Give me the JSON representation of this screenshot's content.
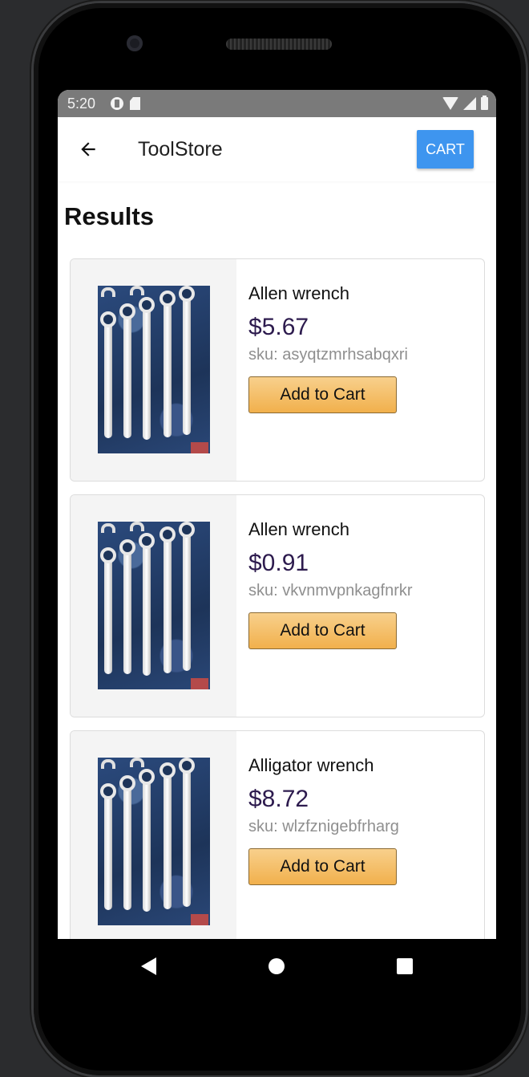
{
  "status_bar": {
    "time": "5:20",
    "left_icons": [
      "data-saver-icon",
      "sd-card-icon"
    ],
    "right_icons": [
      "wifi-icon",
      "signal-icon",
      "battery-icon"
    ]
  },
  "app_bar": {
    "back_icon": "arrow-left-icon",
    "title": "ToolStore",
    "cart_label": "CART",
    "cart_color": "#3e95ef"
  },
  "results": {
    "heading": "Results",
    "items": [
      {
        "name": "Allen wrench",
        "price": "$5.67",
        "sku": "sku: asyqtzmrhsabqxri",
        "button": "Add to Cart",
        "image": "wrench-set-image"
      },
      {
        "name": "Allen wrench",
        "price": "$0.91",
        "sku": "sku: vkvnmvpnkagfnrkr",
        "button": "Add to Cart",
        "image": "wrench-set-image"
      },
      {
        "name": "Alligator wrench",
        "price": "$8.72",
        "sku": "sku: wlzfznigebfrharg",
        "button": "Add to Cart",
        "image": "wrench-set-image"
      }
    ]
  },
  "colors": {
    "price": "#2d1b4e",
    "sku": "#8f8f8f",
    "add_button": "#f1b04c"
  },
  "nav_bar": {
    "icons": [
      "nav-back-icon",
      "nav-home-icon",
      "nav-recents-icon"
    ]
  }
}
